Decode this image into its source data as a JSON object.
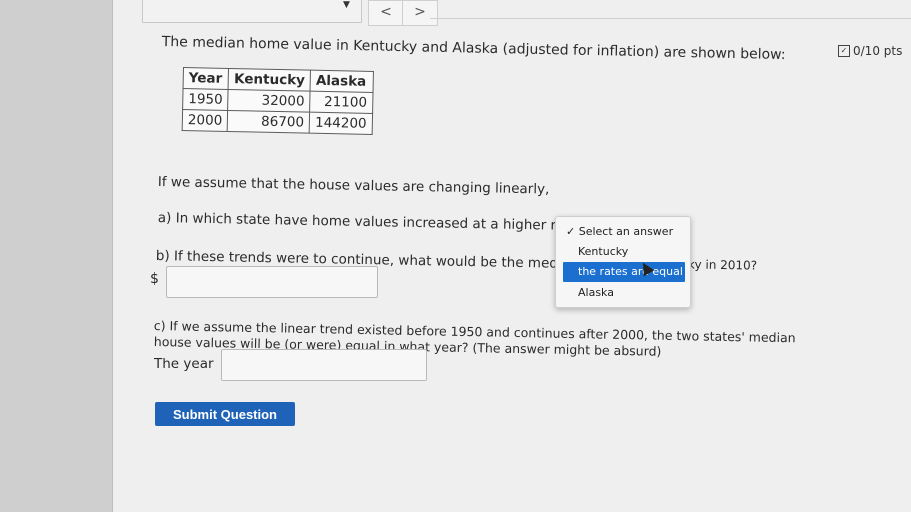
{
  "nav": {
    "prev": "<",
    "next": ">",
    "caret": "▼"
  },
  "score": {
    "label": "0/10 pts",
    "check_icon": "checkbox-icon"
  },
  "question": {
    "intro": "The median home value in Kentucky and Alaska (adjusted for inflation) are shown below:",
    "table": {
      "headers": [
        "Year",
        "Kentucky",
        "Alaska"
      ],
      "rows": [
        [
          "1950",
          "32000",
          "21100"
        ],
        [
          "2000",
          "86700",
          "144200"
        ]
      ]
    },
    "assume": "If we assume that the house values are changing linearly,",
    "part_a": "a) In which state have home values increased at a higher rate",
    "dropdown": {
      "options": [
        "Select an answer",
        "Kentucky",
        "the rates are equal",
        "Alaska"
      ],
      "checked_index": 0,
      "highlighted_index": 2
    },
    "part_b": "b) If these trends were to continue, what would be the media",
    "part_b_end": "ky in 2010?",
    "dollar": "$",
    "part_c_line1": "c) If we assume the linear trend existed before 1950 and continues after 2000, the two states' median",
    "part_c_line2": "house values will be (or were) equal in what year? (The answer might be absurd)",
    "year_label": "The year",
    "submit": "Submit Question"
  }
}
